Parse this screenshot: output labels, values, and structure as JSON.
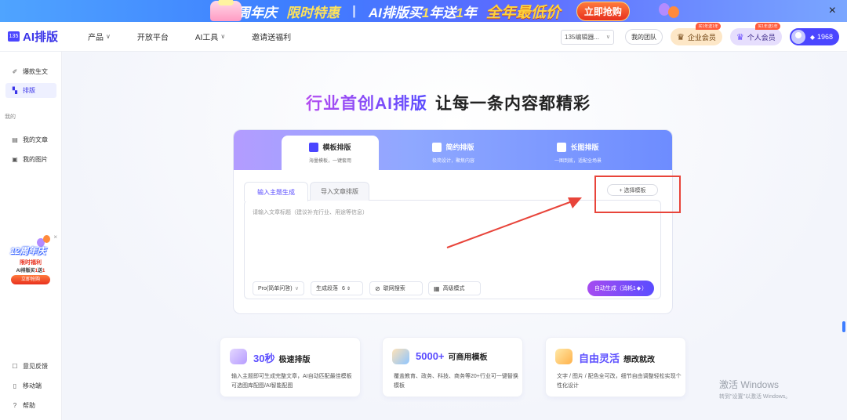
{
  "banner": {
    "year_text": "12周年庆",
    "limited_text": "限时特惠",
    "divider": "|",
    "offer_prefix": "AI排版买",
    "offer_one": "1",
    "offer_mid": "年送",
    "offer_one2": "1",
    "offer_suffix": "年",
    "promo_text": "全年最低价",
    "cta_label": "立即抢购",
    "close_label": "×"
  },
  "header": {
    "logo_mark": "135",
    "logo_text": "AI排版",
    "nav": [
      {
        "label": "产品",
        "chevron": "∨"
      },
      {
        "label": "开放平台",
        "chevron": ""
      },
      {
        "label": "AI工具",
        "chevron": "∨"
      },
      {
        "label": "邀请送福利",
        "chevron": ""
      }
    ],
    "editor_select": "135编辑器...",
    "editor_chevron": "∨",
    "team_label": "我的团队",
    "enterprise_vip": "企业会员",
    "enterprise_tag": "买1年送1年",
    "personal_vip": "个人会员",
    "personal_tag": "买1年送1年",
    "points": "1968"
  },
  "sidebar": {
    "items": [
      {
        "label": "爆款生文",
        "icon": "✐"
      },
      {
        "label": "排版",
        "icon": "▚"
      }
    ],
    "group_label": "我的",
    "my_items": [
      {
        "label": "我的文章",
        "icon": "▤"
      },
      {
        "label": "我的图片",
        "icon": "▣"
      }
    ],
    "promo": {
      "year": "12周年庆",
      "line1": "限时福利",
      "line2_prefix": "AI排版买",
      "line2_num1": "1",
      "line2_mid": "送",
      "line2_num2": "1",
      "cta": "立即抢购",
      "close": "×"
    },
    "bottom_items": [
      {
        "label": "意见反馈",
        "icon": "☐"
      },
      {
        "label": "移动端",
        "icon": "▯"
      },
      {
        "label": "帮助",
        "icon": "?"
      }
    ]
  },
  "main": {
    "headline_gradient": "行业首创AI排版",
    "headline_dark": "让每一条内容都精彩",
    "tabs": [
      {
        "title": "模板排版",
        "sub": "海量模板，一键套用"
      },
      {
        "title": "简约排版",
        "sub": "极简设计，聚焦内容"
      },
      {
        "title": "长图排版",
        "sub": "一图到底，适配全场景"
      }
    ],
    "subtabs": [
      "输入主题生成",
      "导入文章排版"
    ],
    "pick_template": "+ 选择模板",
    "placeholder": "请输入文章标题（建议补充行业、用途等信息）",
    "controls": {
      "mode": "Pro(简单问答)",
      "mode_chevron": "∨",
      "paragraphs_label": "生成段落",
      "paragraphs_value": "6",
      "web_search": "联网搜索",
      "advanced": "高级模式"
    },
    "generate": "自动生成（消耗1",
    "generate_end": "）"
  },
  "features": [
    {
      "big": "30秒",
      "title": "极速排版",
      "desc": "输入主题即可生成完整文章，AI自动匹配最佳模板可选图库配图/AI智能配图"
    },
    {
      "big": "5000+",
      "title": "可商用模板",
      "desc": "覆盖教育、政务、科技、商务等20+行业可一键替换模板"
    },
    {
      "big": "自由灵活",
      "title": "想改就改",
      "desc": "文字 / 图片 / 配色全可改，细节自由调整轻松实现个性化设计"
    }
  ],
  "windows_activation": {
    "title": "激活 Windows",
    "sub": "转到\"设置\"以激活 Windows。"
  },
  "colors": {
    "brand": "#4b46ff",
    "accent_purple": "#a64cf0",
    "annotation_red": "#e8443a"
  }
}
